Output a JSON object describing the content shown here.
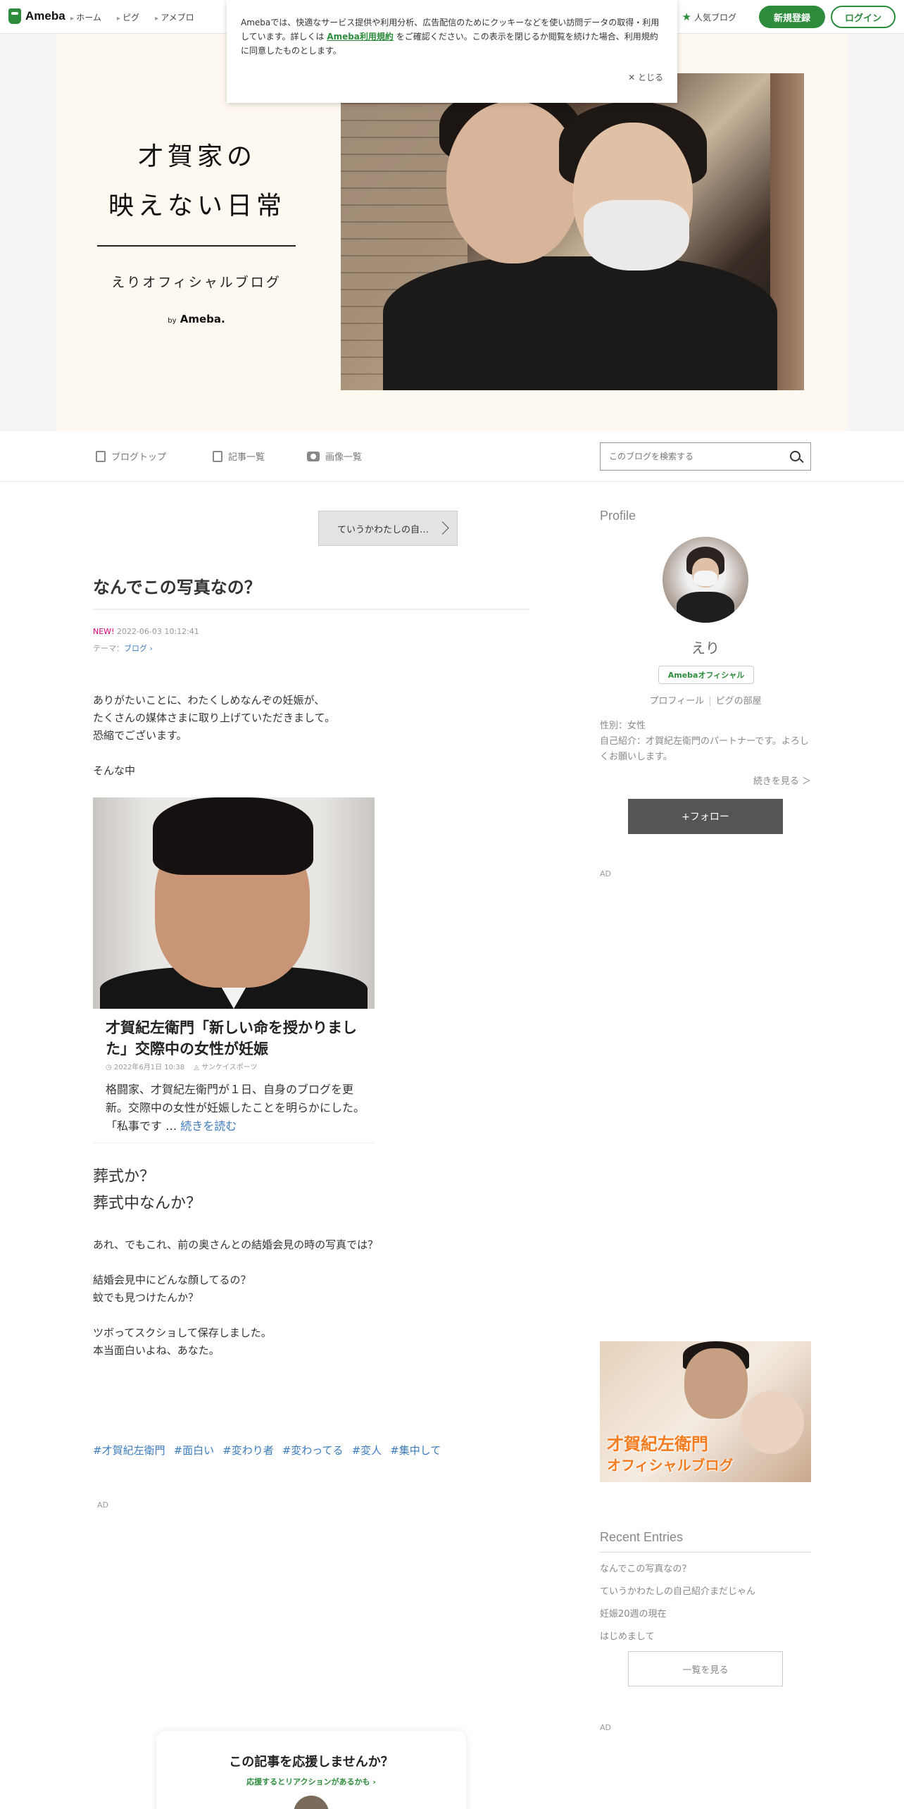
{
  "header": {
    "logo": "Ameba",
    "nav": [
      "ホーム",
      "ピグ",
      "アメブロ"
    ],
    "popular": "人気ブログ",
    "register": "新規登録",
    "login": "ログイン"
  },
  "cookie": {
    "text_before": "Amebaでは、快適なサービス提供や利用分析、広告配信のためにクッキーなどを使い訪問データの取得・利用しています。詳しくは",
    "link": "Ameba利用規約",
    "text_after": "をご確認ください。この表示を閉じるか閲覧を続けた場合、利用規約に同意したものとします。",
    "close": "✕ とじる"
  },
  "hero": {
    "title_line1": "才賀家の",
    "title_line2": "映えない日常",
    "subtitle": "えりオフィシャルブログ",
    "by": "by",
    "brand": "Ameba."
  },
  "blognav": {
    "top": "ブログトップ",
    "list": "記事一覧",
    "images": "画像一覧",
    "search_placeholder": "このブログを検索する"
  },
  "article": {
    "prev": "ていうかわたしの自…",
    "title": "なんでこの写真なの？",
    "new": "NEW!",
    "date": "2022-06-03 10:12:41",
    "theme_label": "テーマ：",
    "theme": "ブログ",
    "p1": "ありがたいことに、わたくしめなんぞの妊娠が、",
    "p2": "たくさんの媒体さまに取り上げていただきまして。",
    "p3": "恐縮でございます。",
    "p4": "そんな中",
    "news": {
      "title": "才賀紀左衛門「新しい命を授かりました」交際中の女性が妊娠",
      "date": "2022年6月1日 10:38",
      "source": "サンケイスポーツ",
      "desc": "格闘家、才賀紀左衛門が１日、自身のブログを更新。交際中の女性が妊娠したことを明らかにした。「私事です …",
      "more": "続きを読む"
    },
    "q1": "葬式か？",
    "q2": "葬式中なんか？",
    "p5": "あれ、でもこれ、前の奥さんとの結婚会見の時の写真では？",
    "p6": "結婚会見中にどんな顔してるの？",
    "p7": "蚊でも見つけたんか？",
    "p8": "ツボってスクショして保存しました。",
    "p9": "本当面白いよね、あなた。",
    "hashtags": [
      "#才賀紀左衛門",
      "#面白い",
      "#変わり者",
      "#変わってる",
      "#変人",
      "#集中して"
    ],
    "ad": "AD",
    "cheer_q": "この記事を応援しませんか？",
    "cheer_sub": "応援するとリアクションがあるかも ›"
  },
  "sidebar": {
    "profile_heading": "Profile",
    "name": "えり",
    "badge": "Amebaオフィシャル",
    "link_profile": "プロフィール",
    "link_room": "ピグの部屋",
    "gender": "性別：女性",
    "intro": "自己紹介：才賀紀左衛門のパートナーです。よろしくお願いします。",
    "more": "続きを見る ＞",
    "follow": "+フォロー",
    "ad1": "AD",
    "banner_line1": "才賀紀左衛門",
    "banner_line2": "オフィシャルブログ",
    "recent_heading": "Recent Entries",
    "recent": [
      "なんでこの写真なの？",
      "ていうかわたしの自己紹介まだじゃん",
      "妊娠20週の現在",
      "はじめまして"
    ],
    "list_all": "一覧を見る",
    "ad2": "AD"
  }
}
